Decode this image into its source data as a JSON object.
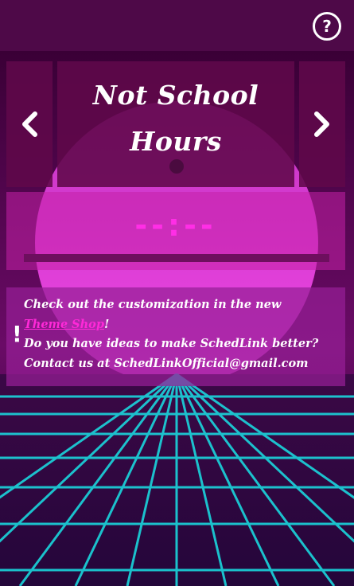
{
  "header": {
    "help_icon": "question-circle-icon",
    "help_label": "?"
  },
  "schedule": {
    "title": "Not School Hours",
    "prev_icon": "chevron-left-icon",
    "next_icon": "chevron-right-icon"
  },
  "timer": {
    "value": "--:--",
    "progress": 0
  },
  "notice": {
    "icon_label": "!",
    "line1_prefix": "Check out the customization in the new",
    "theme_shop_link": "Theme Shop",
    "line1_suffix": "!",
    "line2": "Do you have ideas to make SchedLink better?",
    "line3": "Contact us at SchedLinkOfficial@gmail.com"
  },
  "colors": {
    "accent": "#ff2ee6",
    "header_bg": "#4e0948",
    "grid_line": "#19e2e6"
  }
}
